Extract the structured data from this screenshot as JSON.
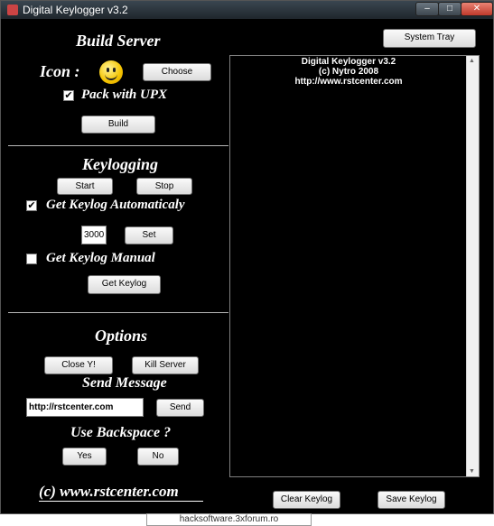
{
  "window": {
    "title": "Digital Keylogger v3.2",
    "minimize": "–",
    "maximize": "□",
    "close": "✕"
  },
  "build": {
    "title": "Build Server",
    "icon_label": "Icon :",
    "choose_label": "Choose",
    "pack_label": "Pack with UPX",
    "pack_checked": "✔",
    "build_label": "Build"
  },
  "keylogging": {
    "title": "Keylogging",
    "start_label": "Start",
    "stop_label": "Stop",
    "auto_label": "Get Keylog Automaticaly",
    "auto_checked": "✔",
    "interval_value": "3000",
    "set_label": "Set",
    "manual_label": "Get Keylog Manual",
    "get_label": "Get Keylog"
  },
  "options": {
    "title": "Options",
    "close_label": "Close Y!",
    "kill_label": "Kill Server",
    "send_title": "Send Message",
    "message_value": "http://rstcenter.com",
    "send_label": "Send",
    "backspace_title": "Use Backspace ?",
    "yes_label": "Yes",
    "no_label": "No"
  },
  "footer_url": "(c) www.rstcenter.com",
  "system_tray_label": "System Tray",
  "log": {
    "lines": [
      "Digital Keylogger v3.2",
      "(c) Nytro 2008",
      "http://www.rstcenter.com"
    ]
  },
  "clear_label": "Clear Keylog",
  "save_label": "Save Keylog",
  "watermark": "hacksoftware.3xforum.ro"
}
